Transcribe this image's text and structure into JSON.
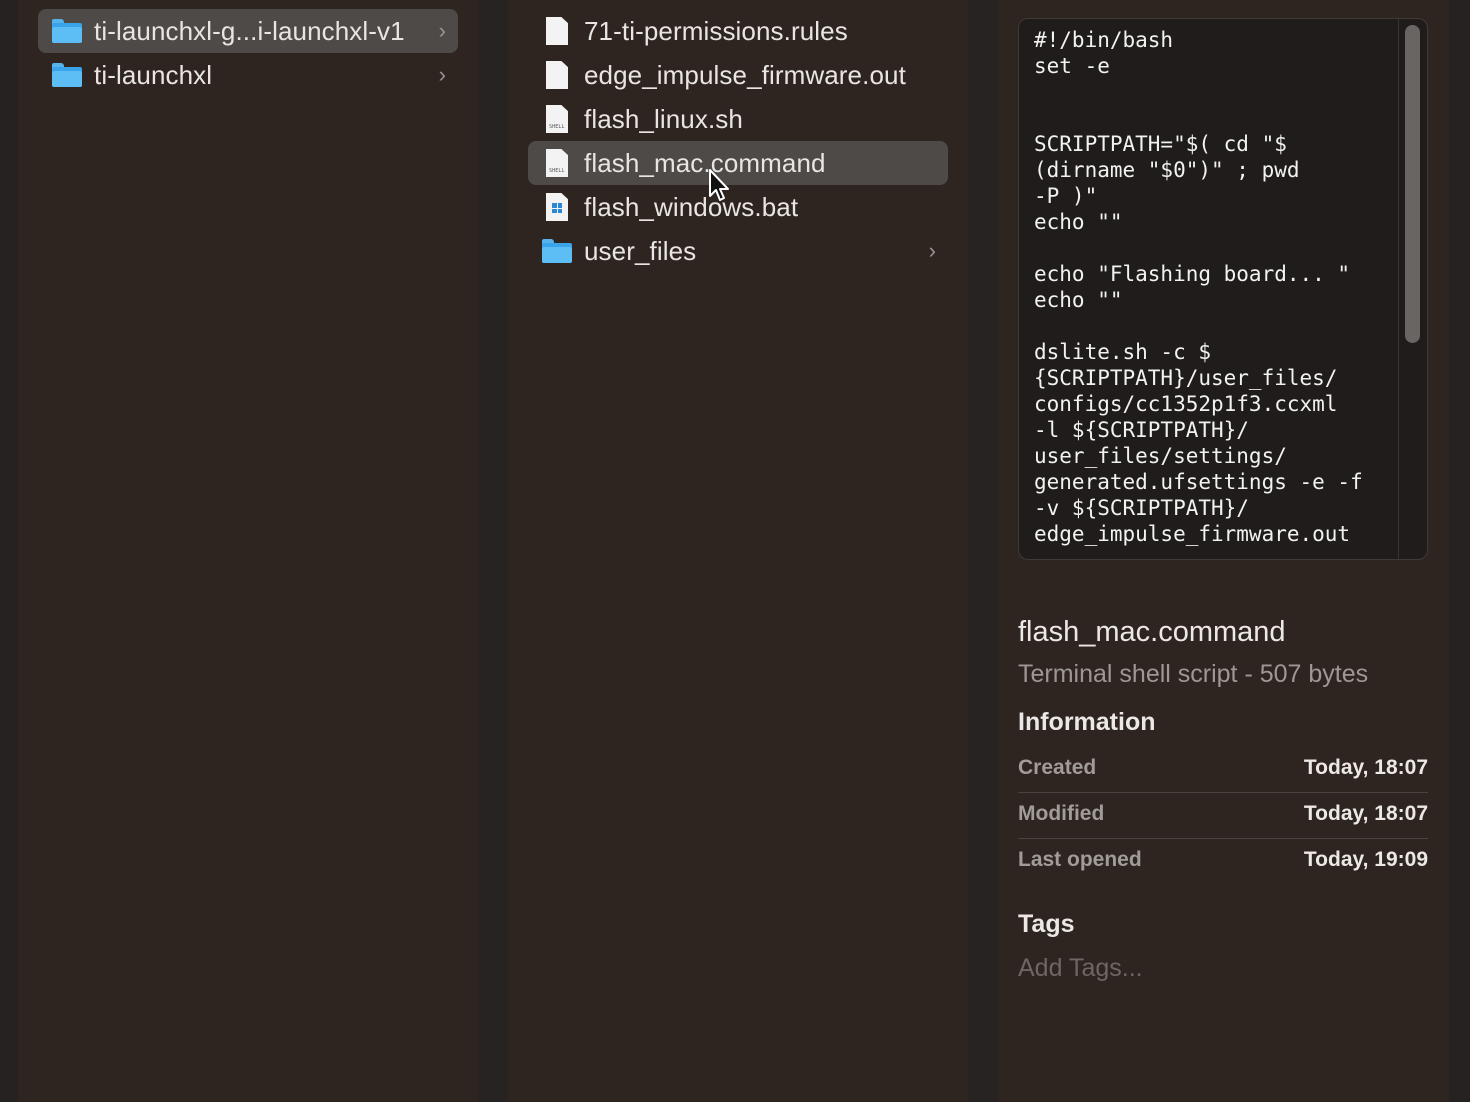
{
  "column1": {
    "items": [
      {
        "label": "ti-launchxl-g...i-launchxl-v1",
        "icon": "folder-icon",
        "selected": true
      },
      {
        "label": "ti-launchxl",
        "icon": "folder-icon",
        "selected": false
      }
    ]
  },
  "column2": {
    "items": [
      {
        "label": "71-ti-permissions.rules",
        "icon": "document-icon"
      },
      {
        "label": "edge_impulse_firmware.out",
        "icon": "document-icon"
      },
      {
        "label": "flash_linux.sh",
        "icon": "shell-script-icon"
      },
      {
        "label": "flash_mac.command",
        "icon": "shell-script-icon",
        "selected": true
      },
      {
        "label": "flash_windows.bat",
        "icon": "windows-batch-icon"
      },
      {
        "label": "user_files",
        "icon": "folder-icon"
      }
    ]
  },
  "preview": {
    "code": "#!/bin/bash\nset -e\n\n\nSCRIPTPATH=\"$( cd \"$\n(dirname \"$0\")\" ; pwd\n-P )\"\necho \"\"\n\necho \"Flashing board... \"\necho \"\"\n\ndslite.sh -c $\n{SCRIPTPATH}/user_files/\nconfigs/cc1352p1f3.ccxml\n-l ${SCRIPTPATH}/\nuser_files/settings/\ngenerated.ufsettings -e -f\n-v ${SCRIPTPATH}/\nedge_impulse_firmware.out"
  },
  "info": {
    "file_name": "flash_mac.command",
    "file_kind": "Terminal shell script - 507 bytes",
    "section_title": "Information",
    "rows": [
      {
        "key": "Created",
        "value": "Today, 18:07"
      },
      {
        "key": "Modified",
        "value": "Today, 18:07"
      },
      {
        "key": "Last opened",
        "value": "Today, 19:09"
      }
    ],
    "tags_title": "Tags",
    "tags_placeholder": "Add Tags..."
  },
  "colors": {
    "background": "#2e2521",
    "selection": "#4e4a48",
    "folder": "#3aa4ea"
  }
}
